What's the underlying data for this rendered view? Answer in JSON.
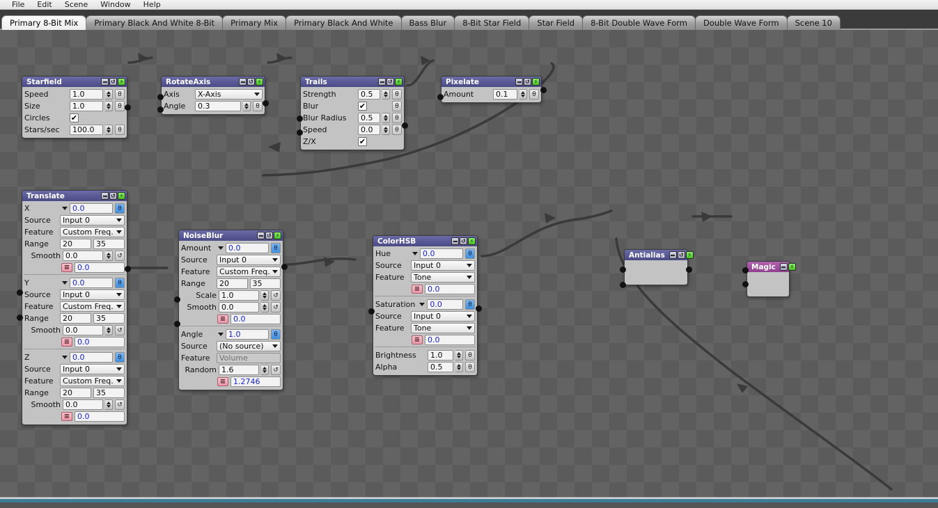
{
  "menubar": {
    "items": [
      {
        "label": "File"
      },
      {
        "label": "Edit"
      },
      {
        "label": "Scene"
      },
      {
        "label": "Window"
      },
      {
        "label": "Help"
      }
    ]
  },
  "tabs": {
    "active_index": 0,
    "items": [
      {
        "label": "Primary 8-Bit Mix"
      },
      {
        "label": "Primary Black And White 8-Bit"
      },
      {
        "label": "Primary Mix"
      },
      {
        "label": "Primary Black And White"
      },
      {
        "label": "Bass Blur"
      },
      {
        "label": "8-Bit Star Field"
      },
      {
        "label": "Star Field"
      },
      {
        "label": "8-Bit Double Wave Form"
      },
      {
        "label": "Double Wave Form"
      },
      {
        "label": "Scene 10"
      }
    ]
  },
  "icons": {
    "minimize": "minimize-icon",
    "cycle": "cycle-icon",
    "power": "power-icon",
    "lock": "lock-link-icon",
    "reset": "reset-cycle-icon",
    "equation": "equation-icon",
    "check": "✔",
    "power_glyph": "⚡",
    "cycle_glyph": "↺",
    "lock_glyph": "θ",
    "eq_glyph": "≡"
  },
  "colors": {
    "node_header": "#4a4a86",
    "node_header_magic": "#91408f",
    "node_body": "#c3c3c3",
    "canvas_dark": "#5b5b5b",
    "canvas_light": "#636363",
    "value_blue": "#1823c8",
    "scrollbar": "#3d7e96",
    "power_green": "#46c220",
    "lock_active": "#3f8ede"
  },
  "nodes": [
    {
      "id": "starfield",
      "title": "Starfield",
      "rows": [
        {
          "label": "Speed",
          "value": "1.0"
        },
        {
          "label": "Size",
          "value": "1.0"
        },
        {
          "label": "Circles",
          "value": "checked"
        },
        {
          "label": "Stars/sec",
          "value": "100.0"
        }
      ]
    },
    {
      "id": "rotateaxis",
      "title": "RotateAxis",
      "rows": [
        {
          "label": "Axis",
          "value": "X-Axis"
        },
        {
          "label": "Angle",
          "value": "0.3"
        }
      ]
    },
    {
      "id": "trails",
      "title": "Trails",
      "rows": [
        {
          "label": "Strength",
          "value": "0.5"
        },
        {
          "label": "Blur",
          "value": "checked"
        },
        {
          "label": "Blur Radius",
          "value": "0.5"
        },
        {
          "label": "Speed",
          "value": "0.0"
        },
        {
          "label": "Z/X",
          "value": "checked"
        }
      ]
    },
    {
      "id": "pixelate",
      "title": "Pixelate",
      "rows": [
        {
          "label": "Amount",
          "value": "0.1"
        }
      ]
    },
    {
      "id": "translate",
      "title": "Translate",
      "groups": [
        {
          "name": "X",
          "value": "0.0",
          "source_label": "Source",
          "source": "Input 0",
          "feature_label": "Feature",
          "feature": "Custom Freq.",
          "range_label": "Range",
          "range_min": "20",
          "range_max": "35",
          "smooth_label": "Smooth",
          "smooth": "0.0",
          "eq_value": "0.0"
        },
        {
          "name": "Y",
          "value": "0.0",
          "source_label": "Source",
          "source": "Input 0",
          "feature_label": "Feature",
          "feature": "Custom Freq.",
          "range_label": "Range",
          "range_min": "20",
          "range_max": "35",
          "smooth_label": "Smooth",
          "smooth": "0.0",
          "eq_value": "0.0"
        },
        {
          "name": "Z",
          "value": "0.0",
          "source_label": "Source",
          "source": "Input 0",
          "feature_label": "Feature",
          "feature": "Custom Freq.",
          "range_label": "Range",
          "range_min": "20",
          "range_max": "35",
          "smooth_label": "Smooth",
          "smooth": "0.0",
          "eq_value": "0.0"
        }
      ]
    },
    {
      "id": "noiseblur",
      "title": "NoiseBlur",
      "group_a": {
        "name": "Amount",
        "value": "0.0",
        "source_label": "Source",
        "source": "Input 0",
        "feature_label": "Feature",
        "feature": "Custom Freq.",
        "range_label": "Range",
        "range_min": "20",
        "range_max": "35",
        "scale_label": "Scale",
        "scale": "1.0",
        "smooth_label": "Smooth",
        "smooth": "0.0",
        "eq_value": "0.0"
      },
      "group_b": {
        "name": "Angle",
        "value": "1.0",
        "source_label": "Source",
        "source": "(No source)",
        "feature_label": "Feature",
        "feature": "Volume",
        "random_label": "Random",
        "random": "1.6",
        "eq_value": "1.2746"
      }
    },
    {
      "id": "colorhsb",
      "title": "ColorHSB",
      "group_a": {
        "name": "Hue",
        "value": "0.0",
        "source_label": "Source",
        "source": "Input 0",
        "feature_label": "Feature",
        "feature": "Tone",
        "eq_value": "0.0"
      },
      "group_b": {
        "name": "Saturation",
        "value": "0.0",
        "source_label": "Source",
        "source": "Input 0",
        "feature_label": "Feature",
        "feature": "Tone",
        "eq_value": "0.0"
      },
      "rows": [
        {
          "label": "Brightness",
          "value": "1.0"
        },
        {
          "label": "Alpha",
          "value": "0.5"
        }
      ]
    },
    {
      "id": "antialias",
      "title": "Antialias",
      "rows": []
    },
    {
      "id": "magic",
      "title": "Magic",
      "rows": []
    }
  ],
  "scrollbar": {
    "orientation": "horizontal",
    "position": 0
  }
}
